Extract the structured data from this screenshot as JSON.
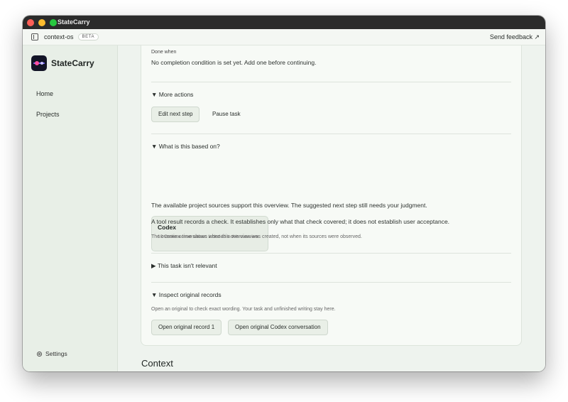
{
  "window": {
    "title": "StateCarry"
  },
  "appbar": {
    "workspace": "context-os",
    "badge": "BETA",
    "feedback": "Send feedback ↗"
  },
  "sidebar": {
    "brand": "StateCarry",
    "items": [
      {
        "label": "Home"
      },
      {
        "label": "Projects"
      }
    ],
    "settings": "Settings"
  },
  "main": {
    "done_when": {
      "label": "Done when",
      "text": "No completion condition is set yet. Add one before continuing."
    },
    "more_actions": {
      "summary": "▼ More actions",
      "edit_button": "Edit next step",
      "pause_button": "Pause task"
    },
    "based_on": {
      "summary": "▼ What is this based on?",
      "source_name": "Codex",
      "source_desc": "10 Codex conversations included in this overview.",
      "para1": "The available project sources support this overview. The suggested next step still needs your judgment.",
      "para2": "A tool result records a check. It establishes only what that check covered; it does not establish user acceptance.",
      "note": "The overview time shows when this overview was created, not when its sources were observed."
    },
    "not_relevant": {
      "summary": "▶ This task isn't relevant"
    },
    "inspect": {
      "summary": "▼ Inspect original records",
      "hint": "Open an original to check exact wording. Your task and unfinished writing stay here.",
      "record_button": "Open original record 1",
      "codex_button": "Open original Codex conversation"
    },
    "context_heading": "Context"
  }
}
